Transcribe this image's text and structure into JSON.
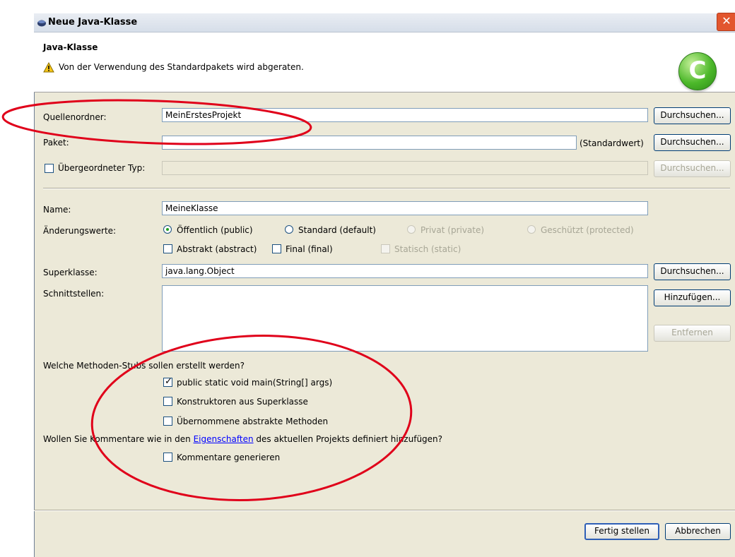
{
  "window": {
    "title": "Neue Java-Klasse",
    "close_glyph": "✕"
  },
  "banner": {
    "heading": "Java-Klasse",
    "message": "Von der Verwendung des Standardpakets wird abgeraten.",
    "icon_letter": "C"
  },
  "form": {
    "source_folder": {
      "label": "Quellenordner:",
      "value": "MeinErstesProjekt",
      "browse": "Durchsuchen..."
    },
    "package": {
      "label": "Paket:",
      "value": "",
      "default_note": "(Standardwert)",
      "browse": "Durchsuchen..."
    },
    "enclosing_type": {
      "label": "Übergeordneter Typ:",
      "checked": false,
      "value": "",
      "browse": "Durchsuchen..."
    },
    "name": {
      "label": "Name:",
      "value": "MeineKlasse"
    },
    "modifiers": {
      "label": "Änderungswerte:",
      "radios": [
        {
          "label": "Öffentlich (public)",
          "selected": true,
          "enabled": true
        },
        {
          "label": "Standard (default)",
          "selected": false,
          "enabled": true
        },
        {
          "label": "Privat (private)",
          "selected": false,
          "enabled": false
        },
        {
          "label": "Geschützt (protected)",
          "selected": false,
          "enabled": false
        }
      ],
      "checks": [
        {
          "label": "Abstrakt (abstract)",
          "checked": false,
          "enabled": true
        },
        {
          "label": "Final (final)",
          "checked": false,
          "enabled": true
        },
        {
          "label": "Statisch (static)",
          "checked": false,
          "enabled": false
        }
      ]
    },
    "superclass": {
      "label": "Superklasse:",
      "value": "java.lang.Object",
      "browse": "Durchsuchen..."
    },
    "interfaces": {
      "label": "Schnittstellen:",
      "add": "Hinzufügen...",
      "remove": "Entfernen"
    },
    "stubs": {
      "question": "Welche Methoden-Stubs sollen erstellt werden?",
      "options": [
        {
          "label": "public static void main(String[] args)",
          "checked": true
        },
        {
          "label": "Konstruktoren aus Superklasse",
          "checked": false
        },
        {
          "label": "Übernommene abstrakte Methoden",
          "checked": false
        }
      ]
    },
    "comments": {
      "question_pre": "Wollen Sie Kommentare wie in den ",
      "question_link": "Eigenschaften",
      "question_post": " des aktuellen Projekts definiert hinzufügen?",
      "option": "Kommentare generieren",
      "checked": false
    }
  },
  "footer": {
    "finish": "Fertig stellen",
    "cancel": "Abbrechen"
  },
  "colors": {
    "dialog_bg": "#ece9d8",
    "annotation_red": "#e0001a",
    "field_border": "#7f9db9"
  }
}
